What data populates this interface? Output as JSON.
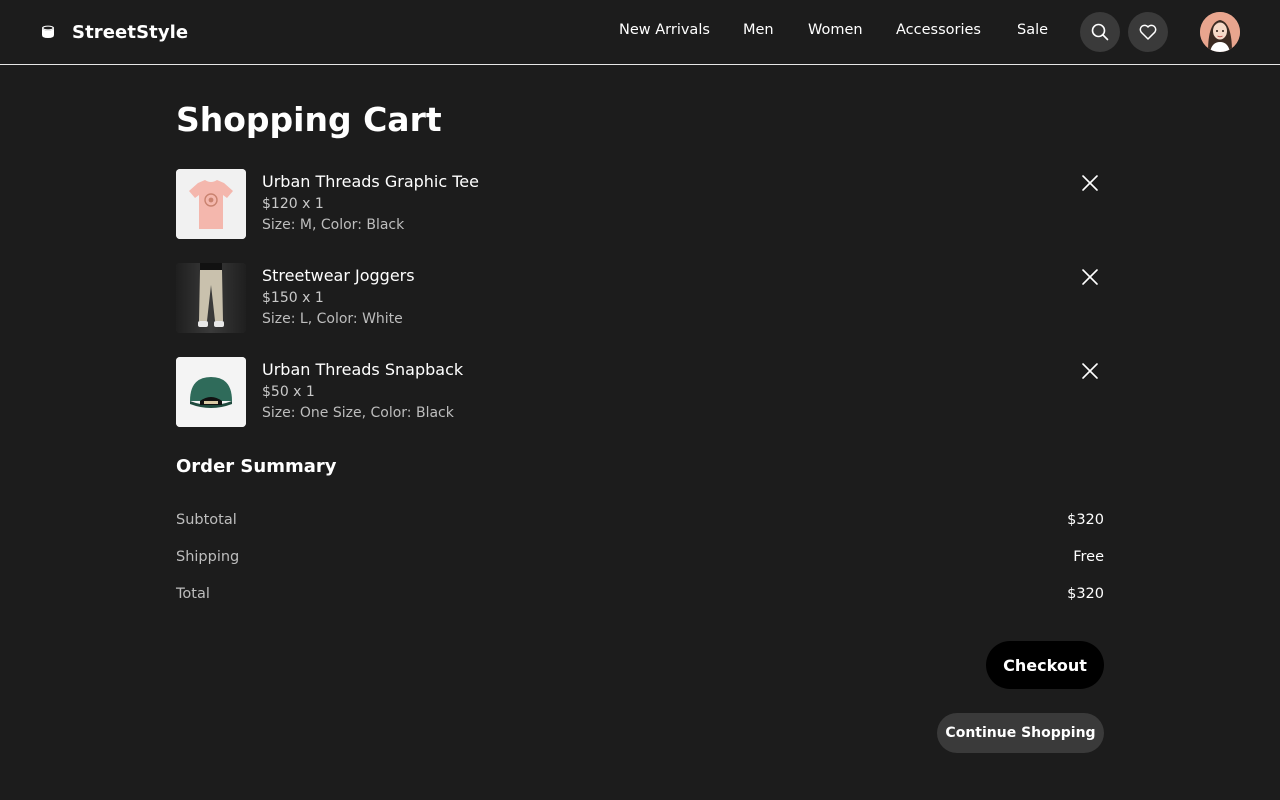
{
  "header": {
    "brand_name": "StreetStyle",
    "brand_icon": "cup-icon",
    "nav": [
      "New Arrivals",
      "Men",
      "Women",
      "Accessories",
      "Sale"
    ],
    "search_icon": "search-icon",
    "wishlist_icon": "heart-icon"
  },
  "cart": {
    "title": "Shopping Cart",
    "items": [
      {
        "name": "Urban Threads Graphic Tee",
        "price": "$120 x 1",
        "meta": "Size: M, Color: Black",
        "image": "pink-tshirt"
      },
      {
        "name": "Streetwear Joggers",
        "price": "$150 x 1",
        "meta": "Size: L, Color: White",
        "image": "beige-joggers"
      },
      {
        "name": "Urban Threads Snapback",
        "price": "$50 x 1",
        "meta": "Size: One Size, Color: Black",
        "image": "green-cap"
      }
    ]
  },
  "summary": {
    "title": "Order Summary",
    "rows": [
      {
        "label": "Subtotal",
        "value": "$320"
      },
      {
        "label": "Shipping",
        "value": "Free"
      },
      {
        "label": "Total",
        "value": "$320"
      }
    ]
  },
  "actions": {
    "checkout": "Checkout",
    "continue": "Continue Shopping"
  },
  "colors": {
    "background": "#1c1c1c",
    "button_dark": "#000000",
    "button_secondary": "#3a3a3a"
  }
}
